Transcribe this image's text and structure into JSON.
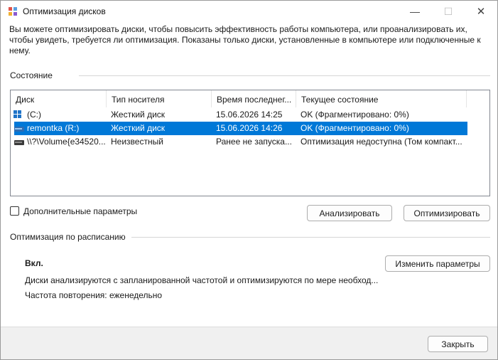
{
  "window": {
    "title": "Оптимизация дисков",
    "controls": {
      "minimize": "—",
      "maximize": "☐",
      "close": "✕"
    }
  },
  "description": "Вы можете оптимизировать диски, чтобы повысить эффективность работы  компьютера, или проанализировать их, чтобы увидеть, требуется ли оптимизация. Показаны только диски, установленные в компьютере или подключенные к нему.",
  "status_group": {
    "label": "Состояние",
    "columns": [
      "Диск",
      "Тип носителя",
      "Время последнег...",
      "Текущее состояние"
    ],
    "rows": [
      {
        "icon": "windows-drive-icon",
        "disk": "(C:)",
        "media": "Жесткий диск",
        "time": "15.06.2026 14:25",
        "state": "OK (Фрагментировано: 0%)",
        "selected": false
      },
      {
        "icon": "removable-drive-icon",
        "disk": "remontka (R:)",
        "media": "Жесткий диск",
        "time": "15.06.2026 14:26",
        "state": "OK (Фрагментировано: 0%)",
        "selected": true
      },
      {
        "icon": "unknown-drive-icon",
        "disk": "\\\\?\\Volume{e34520...",
        "media": "Неизвестный",
        "time": "Ранее не запуска...",
        "state": "Оптимизация недоступна (Том компакт...",
        "selected": false
      }
    ]
  },
  "advanced": {
    "label": "Дополнительные параметры",
    "checked": false
  },
  "buttons": {
    "analyze": "Анализировать",
    "optimize": "Оптимизировать",
    "change_settings": "Изменить параметры",
    "close": "Закрыть"
  },
  "schedule": {
    "label": "Оптимизация по расписанию",
    "status": "Вкл.",
    "info": "Диски анализируются с запланированной частотой и оптимизируются по мере необход...",
    "frequency": "Частота повторения: еженедельно"
  },
  "colors": {
    "selection": "#0078d7",
    "window_bg": "#ffffff",
    "footer_bg": "#f0f0f0"
  }
}
